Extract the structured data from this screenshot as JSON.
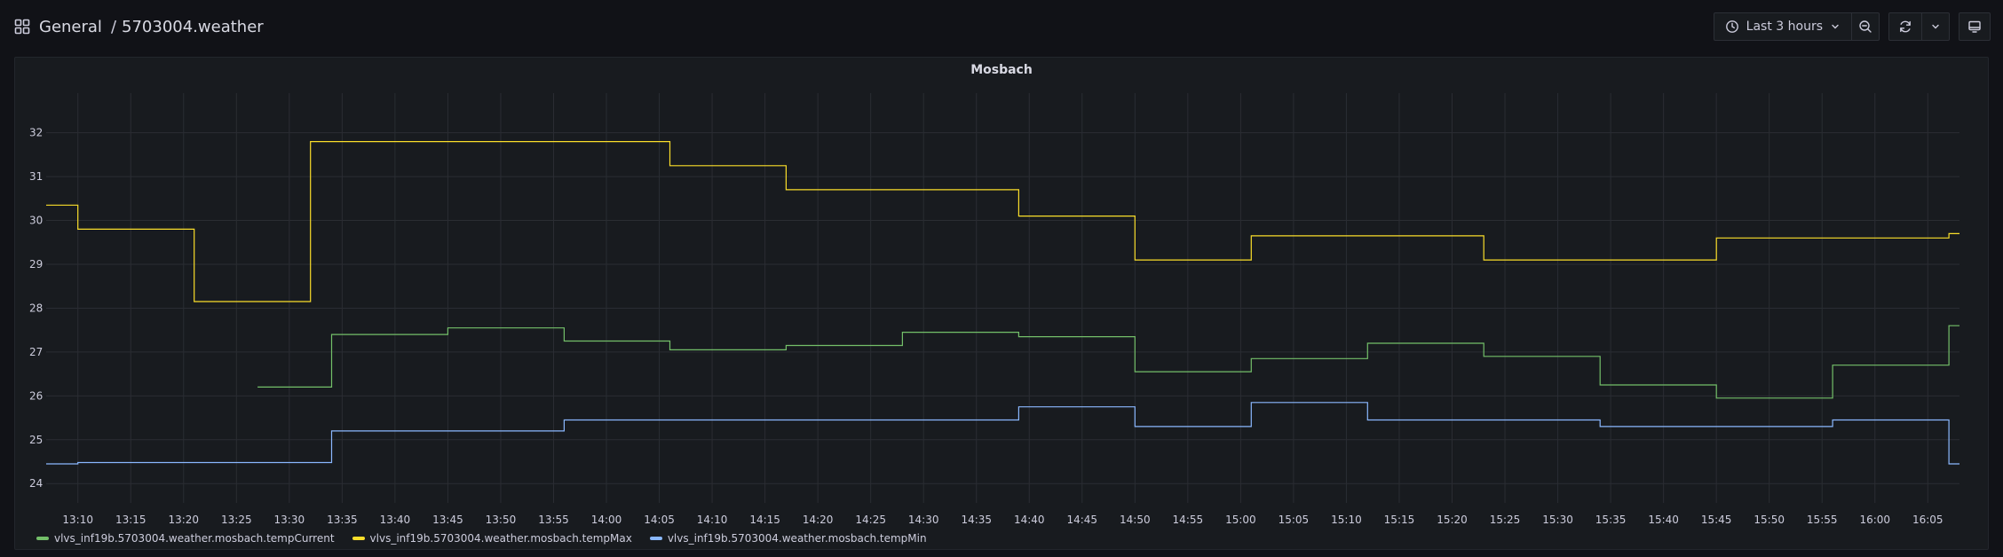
{
  "header": {
    "folder": "General",
    "separator": "/",
    "dashboard": "5703004.weather"
  },
  "toolbar": {
    "time_range": "Last 3 hours"
  },
  "panel": {
    "title": "Mosbach"
  },
  "colors": {
    "tempCurrent": "#73bf69",
    "tempMax": "#fade2a",
    "tempMin": "#8ab8ff"
  },
  "chart_data": {
    "type": "line",
    "title": "Mosbach",
    "xlabel": "",
    "ylabel": "",
    "xlim": [
      "13:07",
      "16:08"
    ],
    "ylim": [
      23.6,
      32.6
    ],
    "x_ticks": [
      "13:10",
      "13:15",
      "13:20",
      "13:25",
      "13:30",
      "13:35",
      "13:40",
      "13:45",
      "13:50",
      "13:55",
      "14:00",
      "14:05",
      "14:10",
      "14:15",
      "14:20",
      "14:25",
      "14:30",
      "14:35",
      "14:40",
      "14:45",
      "14:50",
      "14:55",
      "15:00",
      "15:05",
      "15:10",
      "15:15",
      "15:20",
      "15:25",
      "15:30",
      "15:35",
      "15:40",
      "15:45",
      "15:50",
      "15:55",
      "16:00",
      "16:05"
    ],
    "y_ticks": [
      24,
      25,
      26,
      27,
      28,
      29,
      30,
      31,
      32
    ],
    "grid": true,
    "legend_position": "bottom-left",
    "series": [
      {
        "name": "vlvs_inf19b.5703004.weather.mosbach.tempCurrent",
        "color_key": "tempCurrent",
        "points": [
          [
            "13:27",
            26.2
          ],
          [
            "13:34",
            26.2
          ],
          [
            "13:34",
            27.4
          ],
          [
            "13:45",
            27.4
          ],
          [
            "13:45",
            27.55
          ],
          [
            "13:56",
            27.55
          ],
          [
            "13:56",
            27.25
          ],
          [
            "14:06",
            27.25
          ],
          [
            "14:06",
            27.05
          ],
          [
            "14:17",
            27.05
          ],
          [
            "14:17",
            27.15
          ],
          [
            "14:28",
            27.15
          ],
          [
            "14:28",
            27.45
          ],
          [
            "14:39",
            27.45
          ],
          [
            "14:39",
            27.35
          ],
          [
            "14:50",
            27.35
          ],
          [
            "14:50",
            26.55
          ],
          [
            "15:01",
            26.55
          ],
          [
            "15:01",
            26.85
          ],
          [
            "15:12",
            26.85
          ],
          [
            "15:12",
            27.2
          ],
          [
            "15:23",
            27.2
          ],
          [
            "15:23",
            26.9
          ],
          [
            "15:34",
            26.9
          ],
          [
            "15:34",
            26.25
          ],
          [
            "15:45",
            26.25
          ],
          [
            "15:45",
            25.95
          ],
          [
            "15:56",
            25.95
          ],
          [
            "15:56",
            26.7
          ],
          [
            "16:07",
            26.7
          ],
          [
            "16:07",
            27.6
          ],
          [
            "16:08",
            27.6
          ]
        ]
      },
      {
        "name": "vlvs_inf19b.5703004.weather.mosbach.tempMax",
        "color_key": "tempMax",
        "points": [
          [
            "13:07",
            30.35
          ],
          [
            "13:10",
            30.35
          ],
          [
            "13:10",
            29.8
          ],
          [
            "13:21",
            29.8
          ],
          [
            "13:21",
            28.15
          ],
          [
            "13:32",
            28.15
          ],
          [
            "13:32",
            31.8
          ],
          [
            "14:06",
            31.8
          ],
          [
            "14:06",
            31.25
          ],
          [
            "14:17",
            31.25
          ],
          [
            "14:17",
            30.7
          ],
          [
            "14:39",
            30.7
          ],
          [
            "14:39",
            30.1
          ],
          [
            "14:50",
            30.1
          ],
          [
            "14:50",
            29.1
          ],
          [
            "15:01",
            29.1
          ],
          [
            "15:01",
            29.65
          ],
          [
            "15:23",
            29.65
          ],
          [
            "15:23",
            29.1
          ],
          [
            "15:45",
            29.1
          ],
          [
            "15:45",
            29.6
          ],
          [
            "16:07",
            29.6
          ],
          [
            "16:07",
            29.7
          ],
          [
            "16:08",
            29.7
          ]
        ]
      },
      {
        "name": "vlvs_inf19b.5703004.weather.mosbach.tempMin",
        "color_key": "tempMin",
        "points": [
          [
            "13:07",
            24.45
          ],
          [
            "13:10",
            24.45
          ],
          [
            "13:10",
            24.48
          ],
          [
            "13:34",
            24.48
          ],
          [
            "13:34",
            25.2
          ],
          [
            "13:56",
            25.2
          ],
          [
            "13:56",
            25.45
          ],
          [
            "14:39",
            25.45
          ],
          [
            "14:39",
            25.75
          ],
          [
            "14:50",
            25.75
          ],
          [
            "14:50",
            25.3
          ],
          [
            "15:01",
            25.3
          ],
          [
            "15:01",
            25.85
          ],
          [
            "15:12",
            25.85
          ],
          [
            "15:12",
            25.45
          ],
          [
            "15:34",
            25.45
          ],
          [
            "15:34",
            25.3
          ],
          [
            "15:56",
            25.3
          ],
          [
            "15:56",
            25.45
          ],
          [
            "16:07",
            25.45
          ],
          [
            "16:07",
            24.45
          ],
          [
            "16:08",
            24.45
          ]
        ]
      }
    ]
  }
}
